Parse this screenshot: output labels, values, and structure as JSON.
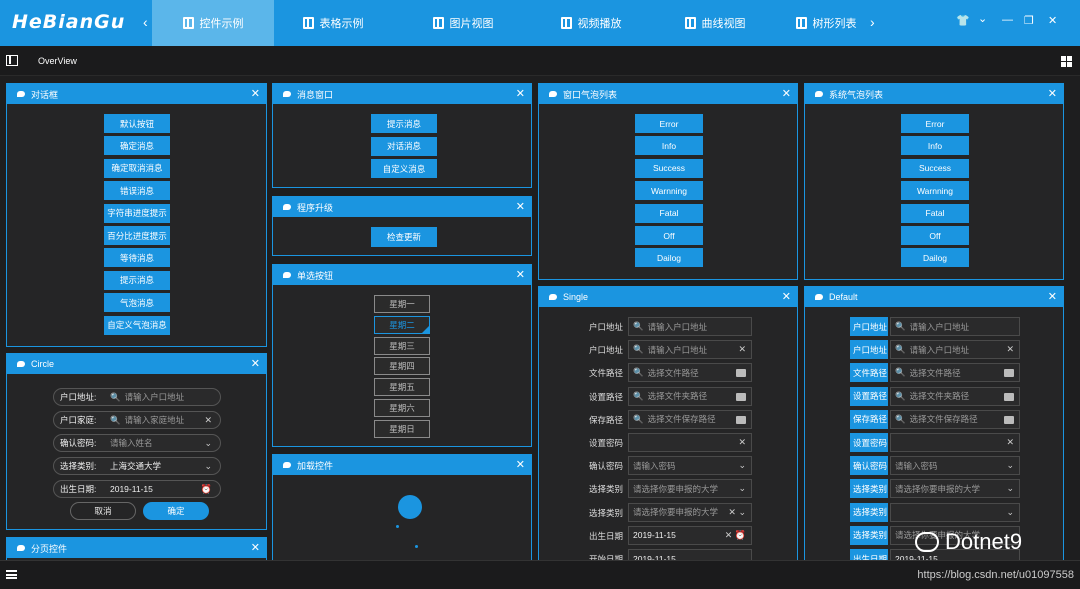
{
  "app": {
    "logo": "HeBianGu",
    "nav_prev": "‹",
    "nav_next": "›",
    "tabs": [
      {
        "label": "控件示例"
      },
      {
        "label": "表格示例"
      },
      {
        "label": "图片视图"
      },
      {
        "label": "视频播放"
      },
      {
        "label": "曲线视图"
      },
      {
        "label": "树形列表"
      }
    ],
    "controls": {
      "shirt": "👕",
      "down": "⌄",
      "min": "—",
      "restore": "❐",
      "close": "✕"
    }
  },
  "subbar": {
    "title": "OverView"
  },
  "dialog": {
    "title": "对话框",
    "buttons": [
      "默认按钮",
      "确定消息",
      "确定取消消息",
      "错误消息",
      "字符串进度提示",
      "百分比进度提示",
      "等待消息",
      "提示消息",
      "气泡消息",
      "自定义气泡消息"
    ]
  },
  "circle": {
    "title": "Circle",
    "fields": [
      {
        "label": "户口地址:",
        "value": "请输入户口地址",
        "icon": "🔍",
        "right": ""
      },
      {
        "label": "户口家庭:",
        "value": "请输入家庭地址",
        "icon": "🔍",
        "right": "✕"
      },
      {
        "label": "确认密码:",
        "value": "请输入姓名",
        "icon": "",
        "right": "⌄"
      },
      {
        "label": "选择类别:",
        "value": "上海交通大学",
        "icon": "",
        "right": "⌄"
      },
      {
        "label": "出生日期:",
        "value": "2019-11-15",
        "icon": "",
        "right": "⏰"
      }
    ],
    "cancel": "取消",
    "ok": "确定"
  },
  "pager": {
    "title": "分页控件"
  },
  "msgwin": {
    "title": "消息窗口",
    "buttons": [
      "提示消息",
      "对话消息",
      "自定义消息"
    ]
  },
  "upgrade": {
    "title": "程序升级",
    "button": "检查更新"
  },
  "radio": {
    "title": "单选按钮",
    "days": [
      "星期一",
      "星期二",
      "星期三",
      "星期四",
      "星期五",
      "星期六",
      "星期日"
    ],
    "selected": 1
  },
  "loading": {
    "title": "加载控件"
  },
  "winbubble": {
    "title": "窗口气泡列表",
    "buttons": [
      "Error",
      "Info",
      "Success",
      "Warnning",
      "Fatal",
      "Off",
      "Dailog"
    ]
  },
  "sysbubble": {
    "title": "系统气泡列表",
    "buttons": [
      "Error",
      "Info",
      "Success",
      "Warnning",
      "Fatal",
      "Off",
      "Dailog"
    ]
  },
  "single": {
    "title": "Single",
    "rows": [
      {
        "label": "户口地址",
        "value": "请输入户口地址",
        "icon": "🔍",
        "right": ""
      },
      {
        "label": "户口地址",
        "value": "请输入户口地址",
        "icon": "🔍",
        "right": "✕"
      },
      {
        "label": "文件路径",
        "value": "选择文件路径",
        "icon": "🔍",
        "right": "folder"
      },
      {
        "label": "设置路径",
        "value": "选择文件夹路径",
        "icon": "🔍",
        "right": "folder"
      },
      {
        "label": "保存路径",
        "value": "选择文件保存路径",
        "icon": "🔍",
        "right": "folder"
      },
      {
        "label": "设置密码",
        "value": "",
        "icon": "",
        "right": "✕"
      },
      {
        "label": "确认密码",
        "value": "请输入密码",
        "icon": "",
        "right": "⌄"
      },
      {
        "label": "选择类别",
        "value": "请选择你要申报的大学",
        "icon": "",
        "right": "⌄"
      },
      {
        "label": "选择类别",
        "value": "请选择你要申报的大学",
        "icon": "",
        "right": "✕ ⌄"
      },
      {
        "label": "出生日期",
        "value": "2019-11-15",
        "icon": "",
        "right": "✕ ⏰"
      },
      {
        "label": "开始日期",
        "value": "2019-11-15",
        "icon": "",
        "right": ""
      }
    ]
  },
  "default": {
    "title": "Default",
    "rows": [
      {
        "label": "户口地址",
        "value": "请输入户口地址",
        "icon": "🔍",
        "right": ""
      },
      {
        "label": "户口地址",
        "value": "请输入户口地址",
        "icon": "🔍",
        "right": "✕"
      },
      {
        "label": "文件路径",
        "value": "选择文件路径",
        "icon": "🔍",
        "right": "folder"
      },
      {
        "label": "设置路径",
        "value": "选择文件夹路径",
        "icon": "🔍",
        "right": "folder"
      },
      {
        "label": "保存路径",
        "value": "选择文件保存路径",
        "icon": "🔍",
        "right": "folder"
      },
      {
        "label": "设置密码",
        "value": "",
        "icon": "",
        "right": "✕"
      },
      {
        "label": "确认密码",
        "value": "请输入密码",
        "icon": "",
        "right": "⌄"
      },
      {
        "label": "选择类别",
        "value": "请选择你要申报的大学",
        "icon": "",
        "right": "⌄"
      },
      {
        "label": "选择类别",
        "value": "",
        "icon": "",
        "right": "⌄"
      },
      {
        "label": "选择类别",
        "value": "请选择你要申报的大学",
        "icon": "",
        "right": ""
      },
      {
        "label": "出生日期",
        "value": "2019-11-15",
        "icon": "",
        "right": ""
      }
    ]
  },
  "status": {
    "url": "https://blog.csdn.net/u01097558"
  },
  "watermark": {
    "text": "Dotnet9"
  }
}
